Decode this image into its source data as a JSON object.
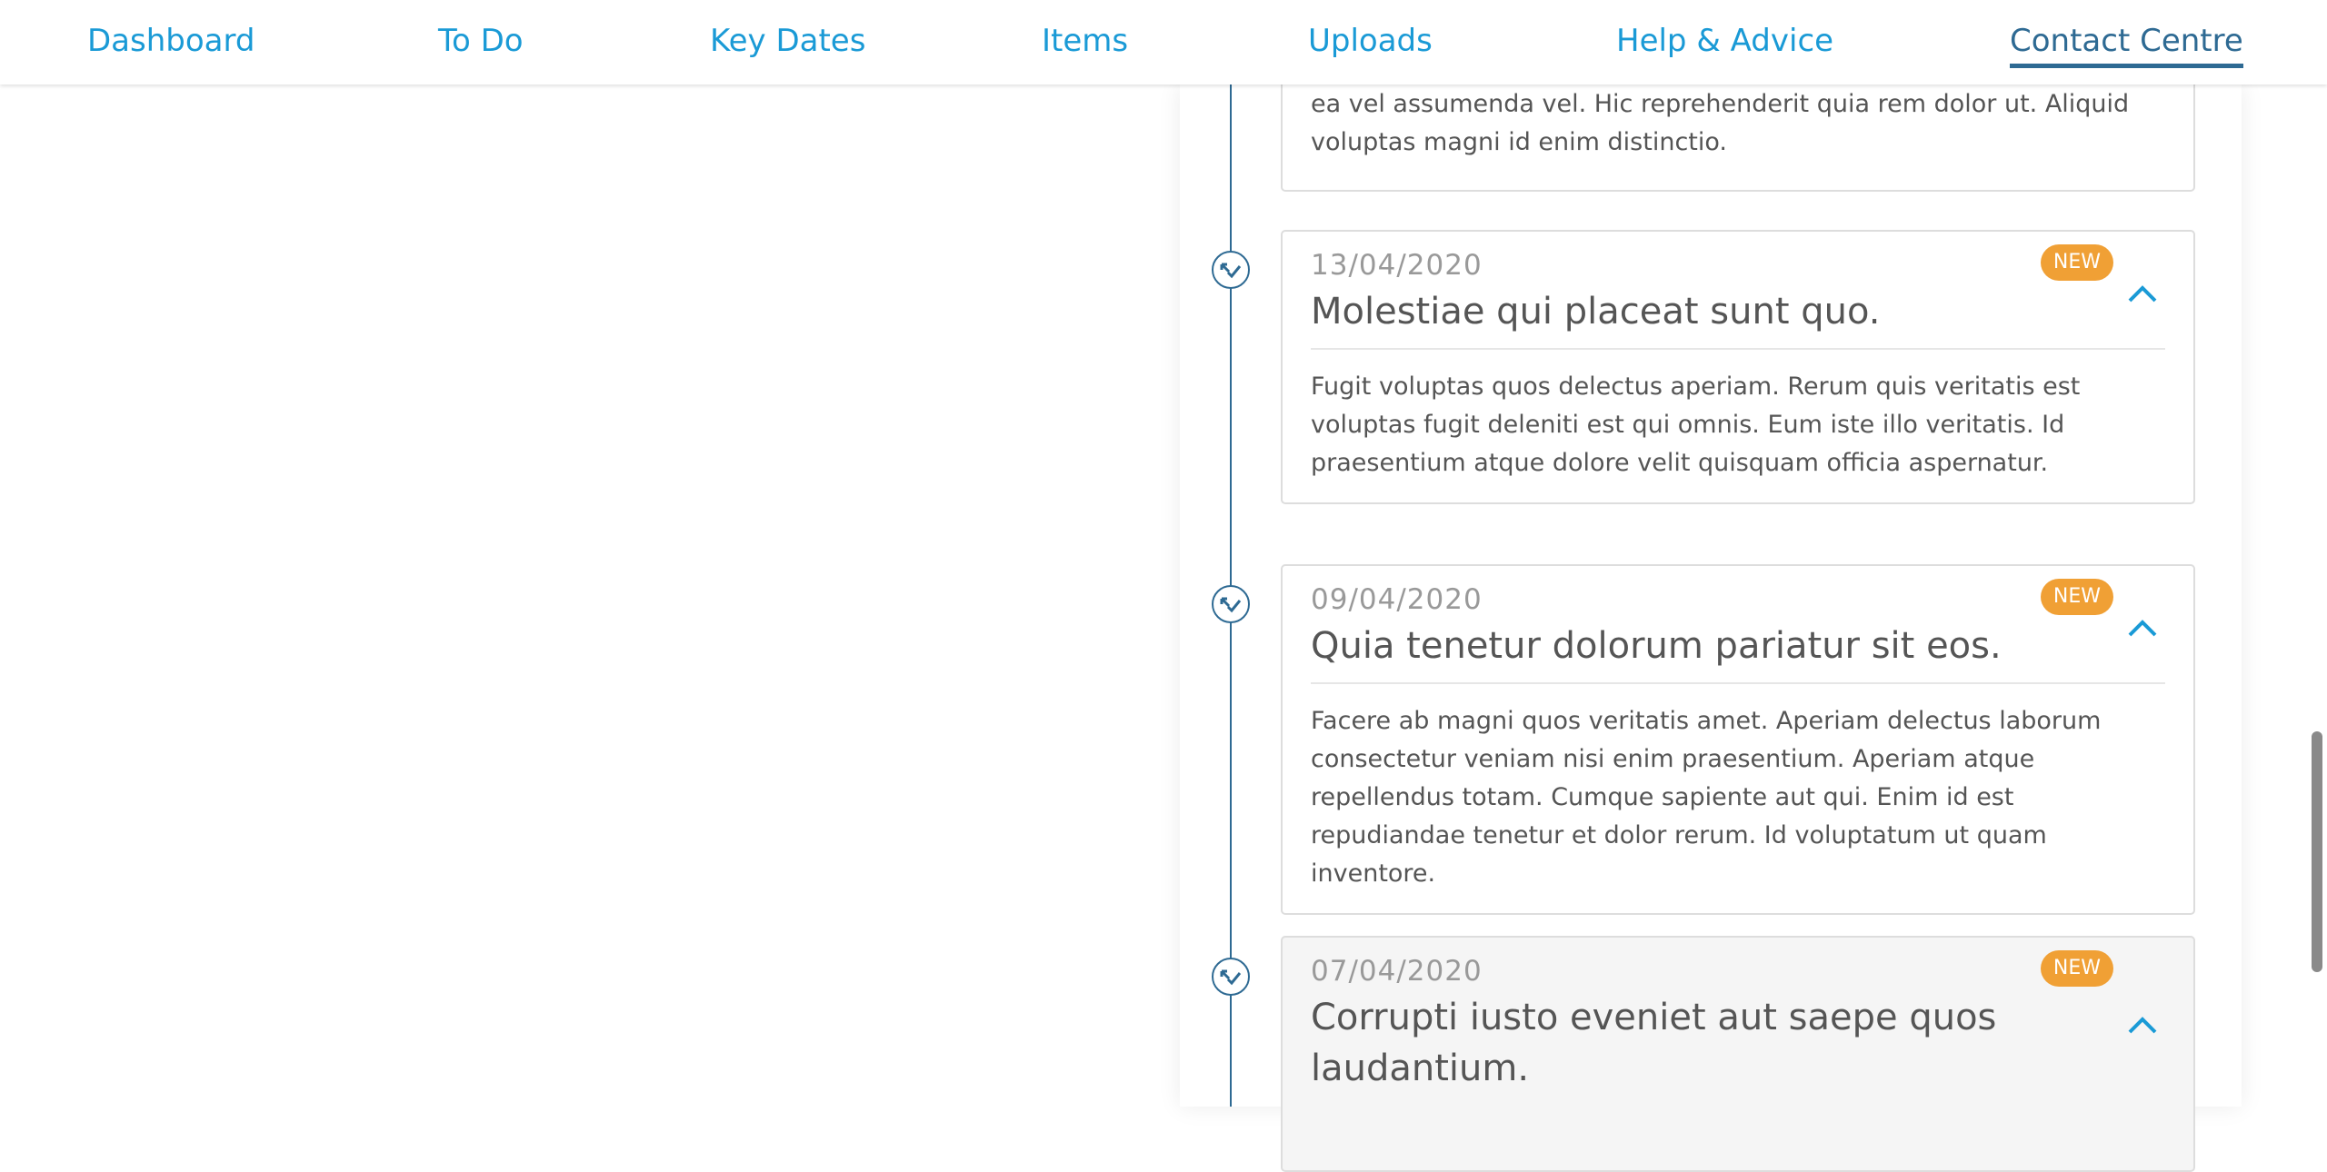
{
  "nav": {
    "items": [
      {
        "label": "Dashboard"
      },
      {
        "label": "To Do"
      },
      {
        "label": "Key Dates"
      },
      {
        "label": "Items"
      },
      {
        "label": "Uploads"
      },
      {
        "label": "Help & Advice"
      },
      {
        "label": "Contact Centre",
        "active": true
      }
    ]
  },
  "colors": {
    "link": "#1a9ad6",
    "active": "#2e6a93",
    "badge": "#f0a035"
  },
  "timeline": {
    "partial_card": {
      "body": "ea vel assumenda vel. Hic reprehenderit quia rem dolor ut. Aliquid voluptas magni id enim distinctio."
    },
    "cards": [
      {
        "date": "13/04/2020",
        "badge": "NEW",
        "title": "Molestiae qui placeat sunt quo.",
        "body": "Fugit voluptas quos delectus aperiam. Rerum quis veritatis est voluptas fugit deleniti est qui omnis. Eum iste illo veritatis. Id praesentium atque dolore velit quisquam officia aspernatur.",
        "icon": "check-arrow-icon"
      },
      {
        "date": "09/04/2020",
        "badge": "NEW",
        "title": "Quia tenetur dolorum pariatur sit eos.",
        "body": "Facere ab magni quos veritatis amet. Aperiam delectus laborum consectetur veniam nisi enim praesentium. Aperiam atque repellendus totam. Cumque sapiente aut qui. Enim id est repudiandae tenetur et dolor rerum. Id voluptatum ut quam inventore.",
        "icon": "check-arrow-icon"
      },
      {
        "date": "07/04/2020",
        "badge": "NEW",
        "title": "Corrupti iusto eveniet aut saepe quos laudantium.",
        "icon": "check-arrow-icon"
      }
    ]
  }
}
